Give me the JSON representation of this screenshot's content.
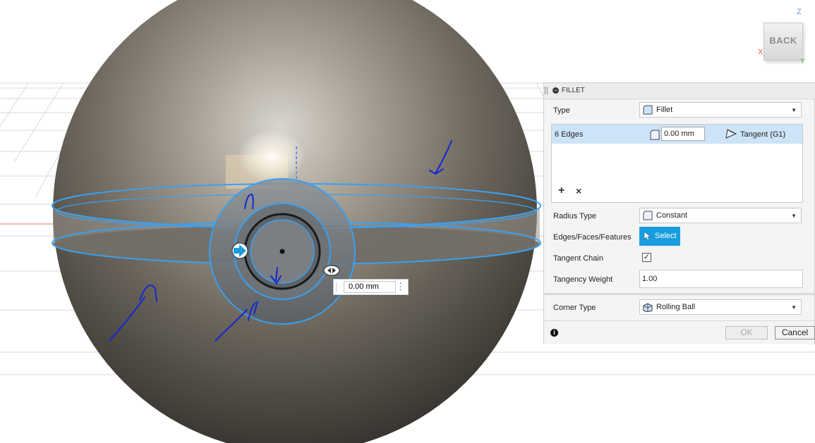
{
  "viewcube": {
    "face_label": "BACK",
    "axis_z": "Z",
    "axis_x": "X",
    "axis_y": "Y",
    "icon": "viewcube-icon"
  },
  "canvas_dimension": {
    "value": "0.00 mm",
    "more_icon": "more-icon"
  },
  "fillet": {
    "title": "FILLET",
    "type": {
      "label": "Type",
      "value": "Fillet",
      "icon": "fillet-icon"
    },
    "edge_set": {
      "name": "6 Edges",
      "radius": "0.00 mm",
      "continuity": "Tangent (G1)",
      "radius_icon": "fillet-radius-icon",
      "continuity_icon": "tangent-icon"
    },
    "add_icon": "plus-icon",
    "remove_icon": "close-icon",
    "radius_type": {
      "label": "Radius Type",
      "value": "Constant",
      "icon": "constant-radius-icon"
    },
    "selection": {
      "label": "Edges/Faces/Features",
      "button": "Select",
      "icon": "cursor-icon"
    },
    "tangent_chain": {
      "label": "Tangent Chain",
      "checked": true
    },
    "tangency_weight": {
      "label": "Tangency Weight",
      "value": "1.00"
    },
    "corner_type": {
      "label": "Corner Type",
      "value": "Rolling Ball",
      "icon": "rolling-ball-icon"
    },
    "buttons": {
      "ok": "OK",
      "cancel": "Cancel"
    },
    "info_icon": "info-icon"
  },
  "colors": {
    "selection_blue": "#3aa0f0",
    "select_button": "#1a9de0",
    "row_highlight": "#cde3f8",
    "annotation_ink": "#1428d0"
  }
}
